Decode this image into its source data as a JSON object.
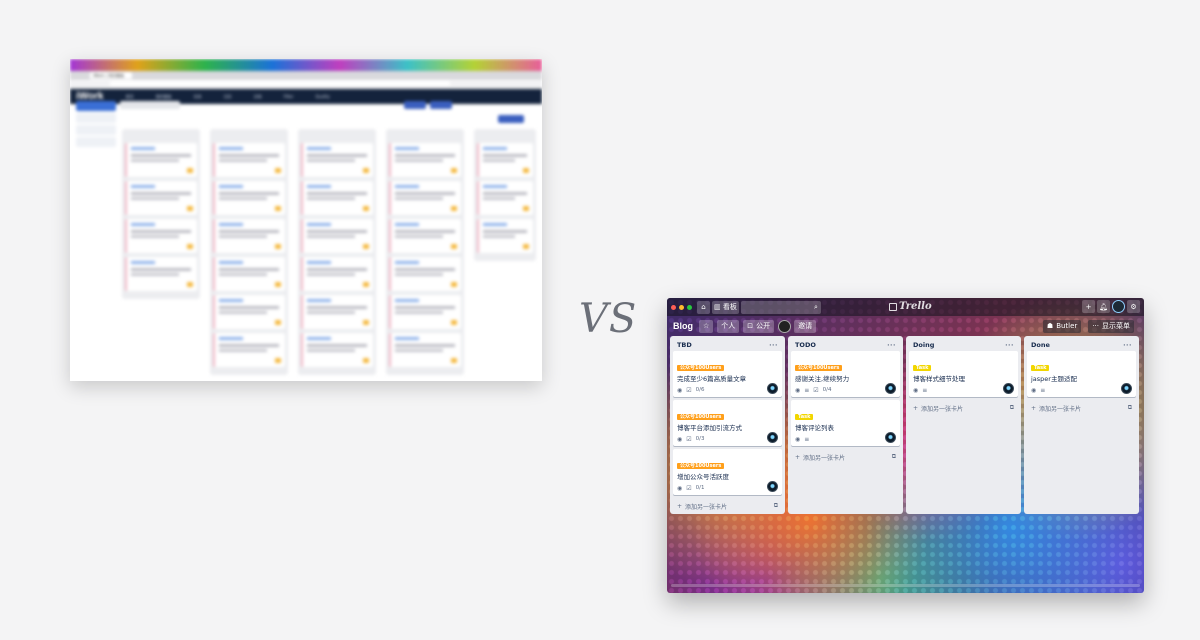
{
  "iwork": {
    "logo": "iWork",
    "tab_title": "iWork | 项目看板",
    "nav_items": [
      "首页",
      "我的看板",
      "任务",
      "日历",
      "文档",
      "Filter",
      "Quality"
    ]
  },
  "vs_text": "VS",
  "trello": {
    "top": {
      "boards_label": "看板",
      "search_icon": "search-icon",
      "logo_text": "Trello",
      "window_dots": [
        "#ff5f56",
        "#ffbd2e",
        "#27c93f"
      ]
    },
    "header": {
      "board_name": "Blog",
      "personal_label": "个人",
      "public_label": "公开",
      "invite_label": "邀请",
      "butler_label": "Butler",
      "menu_label": "显示菜单"
    },
    "lists": [
      {
        "title": "TBD",
        "cards": [
          {
            "label": "公众号100Users",
            "label_color": "orange",
            "title": "完成至少6篇高质量文章",
            "checklist": "0/6"
          },
          {
            "label": "公众号100Users",
            "label_color": "orange",
            "title": "博客平台添加引流方式",
            "checklist": "0/3"
          },
          {
            "label": "公众号100Users",
            "label_color": "orange",
            "title": "增加公众号活跃度",
            "checklist": "0/1"
          }
        ],
        "add_label": "添加另一张卡片"
      },
      {
        "title": "TODO",
        "cards": [
          {
            "label": "公众号100Users",
            "label_color": "orange",
            "title": "感谢关注,继续努力",
            "checklist": "0/4"
          },
          {
            "label": "Task",
            "label_color": "yellow",
            "title": "博客评论列表",
            "checklist": ""
          }
        ],
        "add_label": "添加另一张卡片"
      },
      {
        "title": "Doing",
        "cards": [
          {
            "label": "Task",
            "label_color": "yellow",
            "title": "博客样式细节处理",
            "checklist": ""
          }
        ],
        "add_label": "添加另一张卡片"
      },
      {
        "title": "Done",
        "cards": [
          {
            "label": "Task",
            "label_color": "yellow",
            "title": "jasper主题适配",
            "checklist": ""
          }
        ],
        "add_label": "添加另一张卡片"
      }
    ]
  }
}
